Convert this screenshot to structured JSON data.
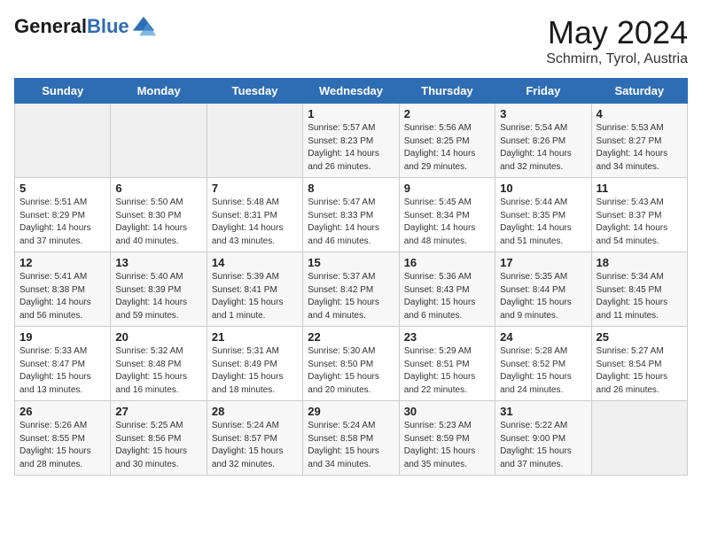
{
  "header": {
    "logo_line1": "General",
    "logo_line2": "Blue",
    "month": "May 2024",
    "location": "Schmirn, Tyrol, Austria"
  },
  "days_of_week": [
    "Sunday",
    "Monday",
    "Tuesday",
    "Wednesday",
    "Thursday",
    "Friday",
    "Saturday"
  ],
  "weeks": [
    [
      {
        "day": "",
        "sunrise": "",
        "sunset": "",
        "daylight": ""
      },
      {
        "day": "",
        "sunrise": "",
        "sunset": "",
        "daylight": ""
      },
      {
        "day": "",
        "sunrise": "",
        "sunset": "",
        "daylight": ""
      },
      {
        "day": "1",
        "sunrise": "Sunrise: 5:57 AM",
        "sunset": "Sunset: 8:23 PM",
        "daylight": "Daylight: 14 hours and 26 minutes."
      },
      {
        "day": "2",
        "sunrise": "Sunrise: 5:56 AM",
        "sunset": "Sunset: 8:25 PM",
        "daylight": "Daylight: 14 hours and 29 minutes."
      },
      {
        "day": "3",
        "sunrise": "Sunrise: 5:54 AM",
        "sunset": "Sunset: 8:26 PM",
        "daylight": "Daylight: 14 hours and 32 minutes."
      },
      {
        "day": "4",
        "sunrise": "Sunrise: 5:53 AM",
        "sunset": "Sunset: 8:27 PM",
        "daylight": "Daylight: 14 hours and 34 minutes."
      }
    ],
    [
      {
        "day": "5",
        "sunrise": "Sunrise: 5:51 AM",
        "sunset": "Sunset: 8:29 PM",
        "daylight": "Daylight: 14 hours and 37 minutes."
      },
      {
        "day": "6",
        "sunrise": "Sunrise: 5:50 AM",
        "sunset": "Sunset: 8:30 PM",
        "daylight": "Daylight: 14 hours and 40 minutes."
      },
      {
        "day": "7",
        "sunrise": "Sunrise: 5:48 AM",
        "sunset": "Sunset: 8:31 PM",
        "daylight": "Daylight: 14 hours and 43 minutes."
      },
      {
        "day": "8",
        "sunrise": "Sunrise: 5:47 AM",
        "sunset": "Sunset: 8:33 PM",
        "daylight": "Daylight: 14 hours and 46 minutes."
      },
      {
        "day": "9",
        "sunrise": "Sunrise: 5:45 AM",
        "sunset": "Sunset: 8:34 PM",
        "daylight": "Daylight: 14 hours and 48 minutes."
      },
      {
        "day": "10",
        "sunrise": "Sunrise: 5:44 AM",
        "sunset": "Sunset: 8:35 PM",
        "daylight": "Daylight: 14 hours and 51 minutes."
      },
      {
        "day": "11",
        "sunrise": "Sunrise: 5:43 AM",
        "sunset": "Sunset: 8:37 PM",
        "daylight": "Daylight: 14 hours and 54 minutes."
      }
    ],
    [
      {
        "day": "12",
        "sunrise": "Sunrise: 5:41 AM",
        "sunset": "Sunset: 8:38 PM",
        "daylight": "Daylight: 14 hours and 56 minutes."
      },
      {
        "day": "13",
        "sunrise": "Sunrise: 5:40 AM",
        "sunset": "Sunset: 8:39 PM",
        "daylight": "Daylight: 14 hours and 59 minutes."
      },
      {
        "day": "14",
        "sunrise": "Sunrise: 5:39 AM",
        "sunset": "Sunset: 8:41 PM",
        "daylight": "Daylight: 15 hours and 1 minute."
      },
      {
        "day": "15",
        "sunrise": "Sunrise: 5:37 AM",
        "sunset": "Sunset: 8:42 PM",
        "daylight": "Daylight: 15 hours and 4 minutes."
      },
      {
        "day": "16",
        "sunrise": "Sunrise: 5:36 AM",
        "sunset": "Sunset: 8:43 PM",
        "daylight": "Daylight: 15 hours and 6 minutes."
      },
      {
        "day": "17",
        "sunrise": "Sunrise: 5:35 AM",
        "sunset": "Sunset: 8:44 PM",
        "daylight": "Daylight: 15 hours and 9 minutes."
      },
      {
        "day": "18",
        "sunrise": "Sunrise: 5:34 AM",
        "sunset": "Sunset: 8:45 PM",
        "daylight": "Daylight: 15 hours and 11 minutes."
      }
    ],
    [
      {
        "day": "19",
        "sunrise": "Sunrise: 5:33 AM",
        "sunset": "Sunset: 8:47 PM",
        "daylight": "Daylight: 15 hours and 13 minutes."
      },
      {
        "day": "20",
        "sunrise": "Sunrise: 5:32 AM",
        "sunset": "Sunset: 8:48 PM",
        "daylight": "Daylight: 15 hours and 16 minutes."
      },
      {
        "day": "21",
        "sunrise": "Sunrise: 5:31 AM",
        "sunset": "Sunset: 8:49 PM",
        "daylight": "Daylight: 15 hours and 18 minutes."
      },
      {
        "day": "22",
        "sunrise": "Sunrise: 5:30 AM",
        "sunset": "Sunset: 8:50 PM",
        "daylight": "Daylight: 15 hours and 20 minutes."
      },
      {
        "day": "23",
        "sunrise": "Sunrise: 5:29 AM",
        "sunset": "Sunset: 8:51 PM",
        "daylight": "Daylight: 15 hours and 22 minutes."
      },
      {
        "day": "24",
        "sunrise": "Sunrise: 5:28 AM",
        "sunset": "Sunset: 8:52 PM",
        "daylight": "Daylight: 15 hours and 24 minutes."
      },
      {
        "day": "25",
        "sunrise": "Sunrise: 5:27 AM",
        "sunset": "Sunset: 8:54 PM",
        "daylight": "Daylight: 15 hours and 26 minutes."
      }
    ],
    [
      {
        "day": "26",
        "sunrise": "Sunrise: 5:26 AM",
        "sunset": "Sunset: 8:55 PM",
        "daylight": "Daylight: 15 hours and 28 minutes."
      },
      {
        "day": "27",
        "sunrise": "Sunrise: 5:25 AM",
        "sunset": "Sunset: 8:56 PM",
        "daylight": "Daylight: 15 hours and 30 minutes."
      },
      {
        "day": "28",
        "sunrise": "Sunrise: 5:24 AM",
        "sunset": "Sunset: 8:57 PM",
        "daylight": "Daylight: 15 hours and 32 minutes."
      },
      {
        "day": "29",
        "sunrise": "Sunrise: 5:24 AM",
        "sunset": "Sunset: 8:58 PM",
        "daylight": "Daylight: 15 hours and 34 minutes."
      },
      {
        "day": "30",
        "sunrise": "Sunrise: 5:23 AM",
        "sunset": "Sunset: 8:59 PM",
        "daylight": "Daylight: 15 hours and 35 minutes."
      },
      {
        "day": "31",
        "sunrise": "Sunrise: 5:22 AM",
        "sunset": "Sunset: 9:00 PM",
        "daylight": "Daylight: 15 hours and 37 minutes."
      },
      {
        "day": "",
        "sunrise": "",
        "sunset": "",
        "daylight": ""
      }
    ]
  ]
}
